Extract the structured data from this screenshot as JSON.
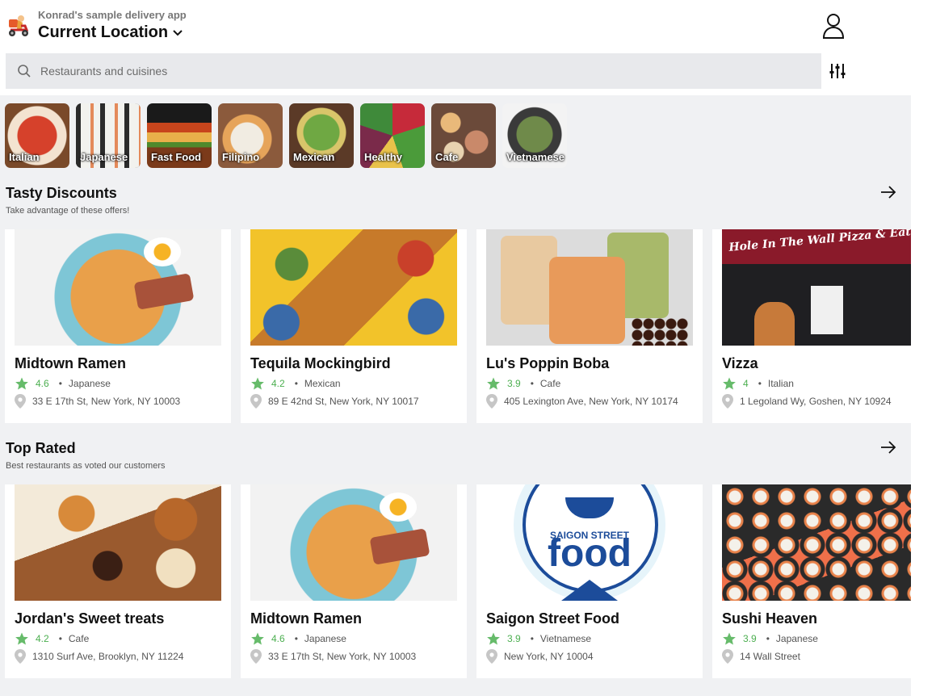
{
  "header": {
    "app_name": "Konrad's sample delivery app",
    "location": "Current Location"
  },
  "search": {
    "placeholder": "Restaurants and cuisines"
  },
  "categories": [
    {
      "label": "Italian"
    },
    {
      "label": "Japanese"
    },
    {
      "label": "Fast Food"
    },
    {
      "label": "Filipino"
    },
    {
      "label": "Mexican"
    },
    {
      "label": "Healthy"
    },
    {
      "label": "Cafe"
    },
    {
      "label": "Vietnamese"
    }
  ],
  "sections": [
    {
      "title": "Tasty Discounts",
      "subtitle": "Take advantage of these offers!",
      "restaurants": [
        {
          "name": "Midtown Ramen",
          "rating": "4.6",
          "cuisine": "Japanese",
          "address": "33 E 17th St, New York, NY 10003"
        },
        {
          "name": "Tequila Mockingbird",
          "rating": "4.2",
          "cuisine": "Mexican",
          "address": "89 E 42nd St, New York, NY 10017"
        },
        {
          "name": "Lu's Poppin Boba",
          "rating": "3.9",
          "cuisine": "Cafe",
          "address": "405 Lexington Ave, New York, NY 10174"
        },
        {
          "name": "Vizza",
          "rating": "4",
          "cuisine": "Italian",
          "address": "1 Legoland Wy, Goshen, NY 10924",
          "sign_text": "Hole In The Wall Pizza & Eatery"
        }
      ]
    },
    {
      "title": "Top Rated",
      "subtitle": "Best restaurants as voted our customers",
      "restaurants": [
        {
          "name": "Jordan's Sweet treats",
          "rating": "4.2",
          "cuisine": "Cafe",
          "address": "1310 Surf Ave, Brooklyn, NY 11224"
        },
        {
          "name": "Midtown Ramen",
          "rating": "4.6",
          "cuisine": "Japanese",
          "address": "33 E 17th St, New York, NY 10003"
        },
        {
          "name": "Saigon Street Food",
          "rating": "3.9",
          "cuisine": "Vietnamese",
          "address": "New York, NY 10004",
          "logo_text_top": "SAIGON STREET",
          "logo_text_main": "food"
        },
        {
          "name": "Sushi Heaven",
          "rating": "3.9",
          "cuisine": "Japanese",
          "address": "14 Wall Street"
        }
      ]
    }
  ],
  "colors": {
    "rating_green": "#4caf50",
    "content_bg": "#f0f1f3",
    "search_bg": "#e8e9ec"
  }
}
